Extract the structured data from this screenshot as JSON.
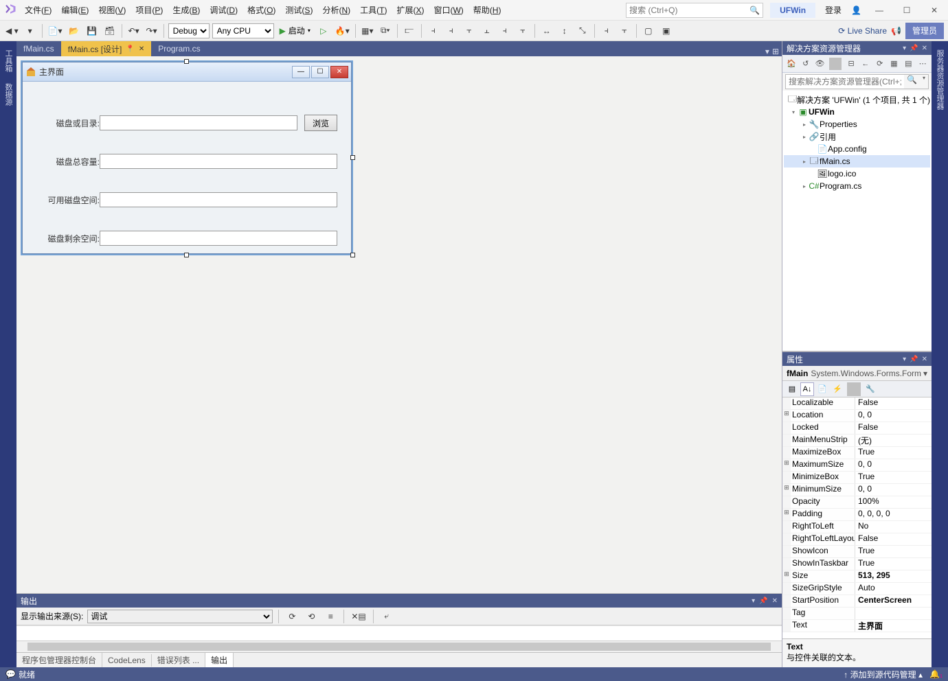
{
  "titlebar": {
    "menus": [
      "文件(F)",
      "编辑(E)",
      "视图(V)",
      "项目(P)",
      "生成(B)",
      "调试(D)",
      "格式(O)",
      "测试(S)",
      "分析(N)",
      "工具(T)",
      "扩展(X)",
      "窗口(W)",
      "帮助(H)"
    ],
    "search_placeholder": "搜索 (Ctrl+Q)",
    "project_badge": "UFWin",
    "login": "登录"
  },
  "toolbar": {
    "config": "Debug",
    "platform": "Any CPU",
    "start": "启动",
    "liveshare": "Live Share",
    "admin": "管理员"
  },
  "lefttabs": [
    "工具箱",
    "数据源"
  ],
  "righttabs": [
    "服务器资源管理器"
  ],
  "doctabs": {
    "tabs": [
      {
        "label": "fMain.cs",
        "active": false
      },
      {
        "label": "fMain.cs [设计]",
        "active": true
      },
      {
        "label": "Program.cs",
        "active": false
      }
    ]
  },
  "form_designer": {
    "title": "主界面",
    "browse": "浏览",
    "labels": {
      "path": "磁盘或目录:",
      "total": "磁盘总容量:",
      "free": "可用磁盘空间:",
      "remain": "磁盘剩余空间:"
    }
  },
  "output": {
    "title": "输出",
    "source_label": "显示输出来源(S):",
    "source_value": "调试"
  },
  "tooltabs": [
    "程序包管理器控制台",
    "CodeLens",
    "错误列表 ...",
    "输出"
  ],
  "solution": {
    "title": "解决方案资源管理器",
    "search_placeholder": "搜索解决方案资源管理器(Ctrl+;)",
    "root": "解决方案 'UFWin' (1 个项目, 共 1 个)",
    "project": "UFWin",
    "items": {
      "properties": "Properties",
      "refs": "引用",
      "appconfig": "App.config",
      "fmain": "fMain.cs",
      "logo": "logo.ico",
      "program": "Program.cs"
    }
  },
  "properties": {
    "title": "属性",
    "object": "fMain",
    "object_type": "System.Windows.Forms.Form",
    "rows": [
      {
        "exp": "",
        "name": "Localizable",
        "val": "False"
      },
      {
        "exp": "⊞",
        "name": "Location",
        "val": "0, 0"
      },
      {
        "exp": "",
        "name": "Locked",
        "val": "False"
      },
      {
        "exp": "",
        "name": "MainMenuStrip",
        "val": "(无)"
      },
      {
        "exp": "",
        "name": "MaximizeBox",
        "val": "True"
      },
      {
        "exp": "⊞",
        "name": "MaximumSize",
        "val": "0, 0"
      },
      {
        "exp": "",
        "name": "MinimizeBox",
        "val": "True"
      },
      {
        "exp": "⊞",
        "name": "MinimumSize",
        "val": "0, 0"
      },
      {
        "exp": "",
        "name": "Opacity",
        "val": "100%"
      },
      {
        "exp": "⊞",
        "name": "Padding",
        "val": "0, 0, 0, 0"
      },
      {
        "exp": "",
        "name": "RightToLeft",
        "val": "No"
      },
      {
        "exp": "",
        "name": "RightToLeftLayout",
        "val": "False"
      },
      {
        "exp": "",
        "name": "ShowIcon",
        "val": "True"
      },
      {
        "exp": "",
        "name": "ShowInTaskbar",
        "val": "True"
      },
      {
        "exp": "⊞",
        "name": "Size",
        "val": "513, 295",
        "bold": true
      },
      {
        "exp": "",
        "name": "SizeGripStyle",
        "val": "Auto"
      },
      {
        "exp": "",
        "name": "StartPosition",
        "val": "CenterScreen",
        "bold": true
      },
      {
        "exp": "",
        "name": "Tag",
        "val": ""
      },
      {
        "exp": "",
        "name": "Text",
        "val": "主界面",
        "bold": true
      }
    ],
    "desc_name": "Text",
    "desc_text": "与控件关联的文本。"
  },
  "statusbar": {
    "ready": "就绪",
    "src_control": "添加到源代码管理"
  }
}
